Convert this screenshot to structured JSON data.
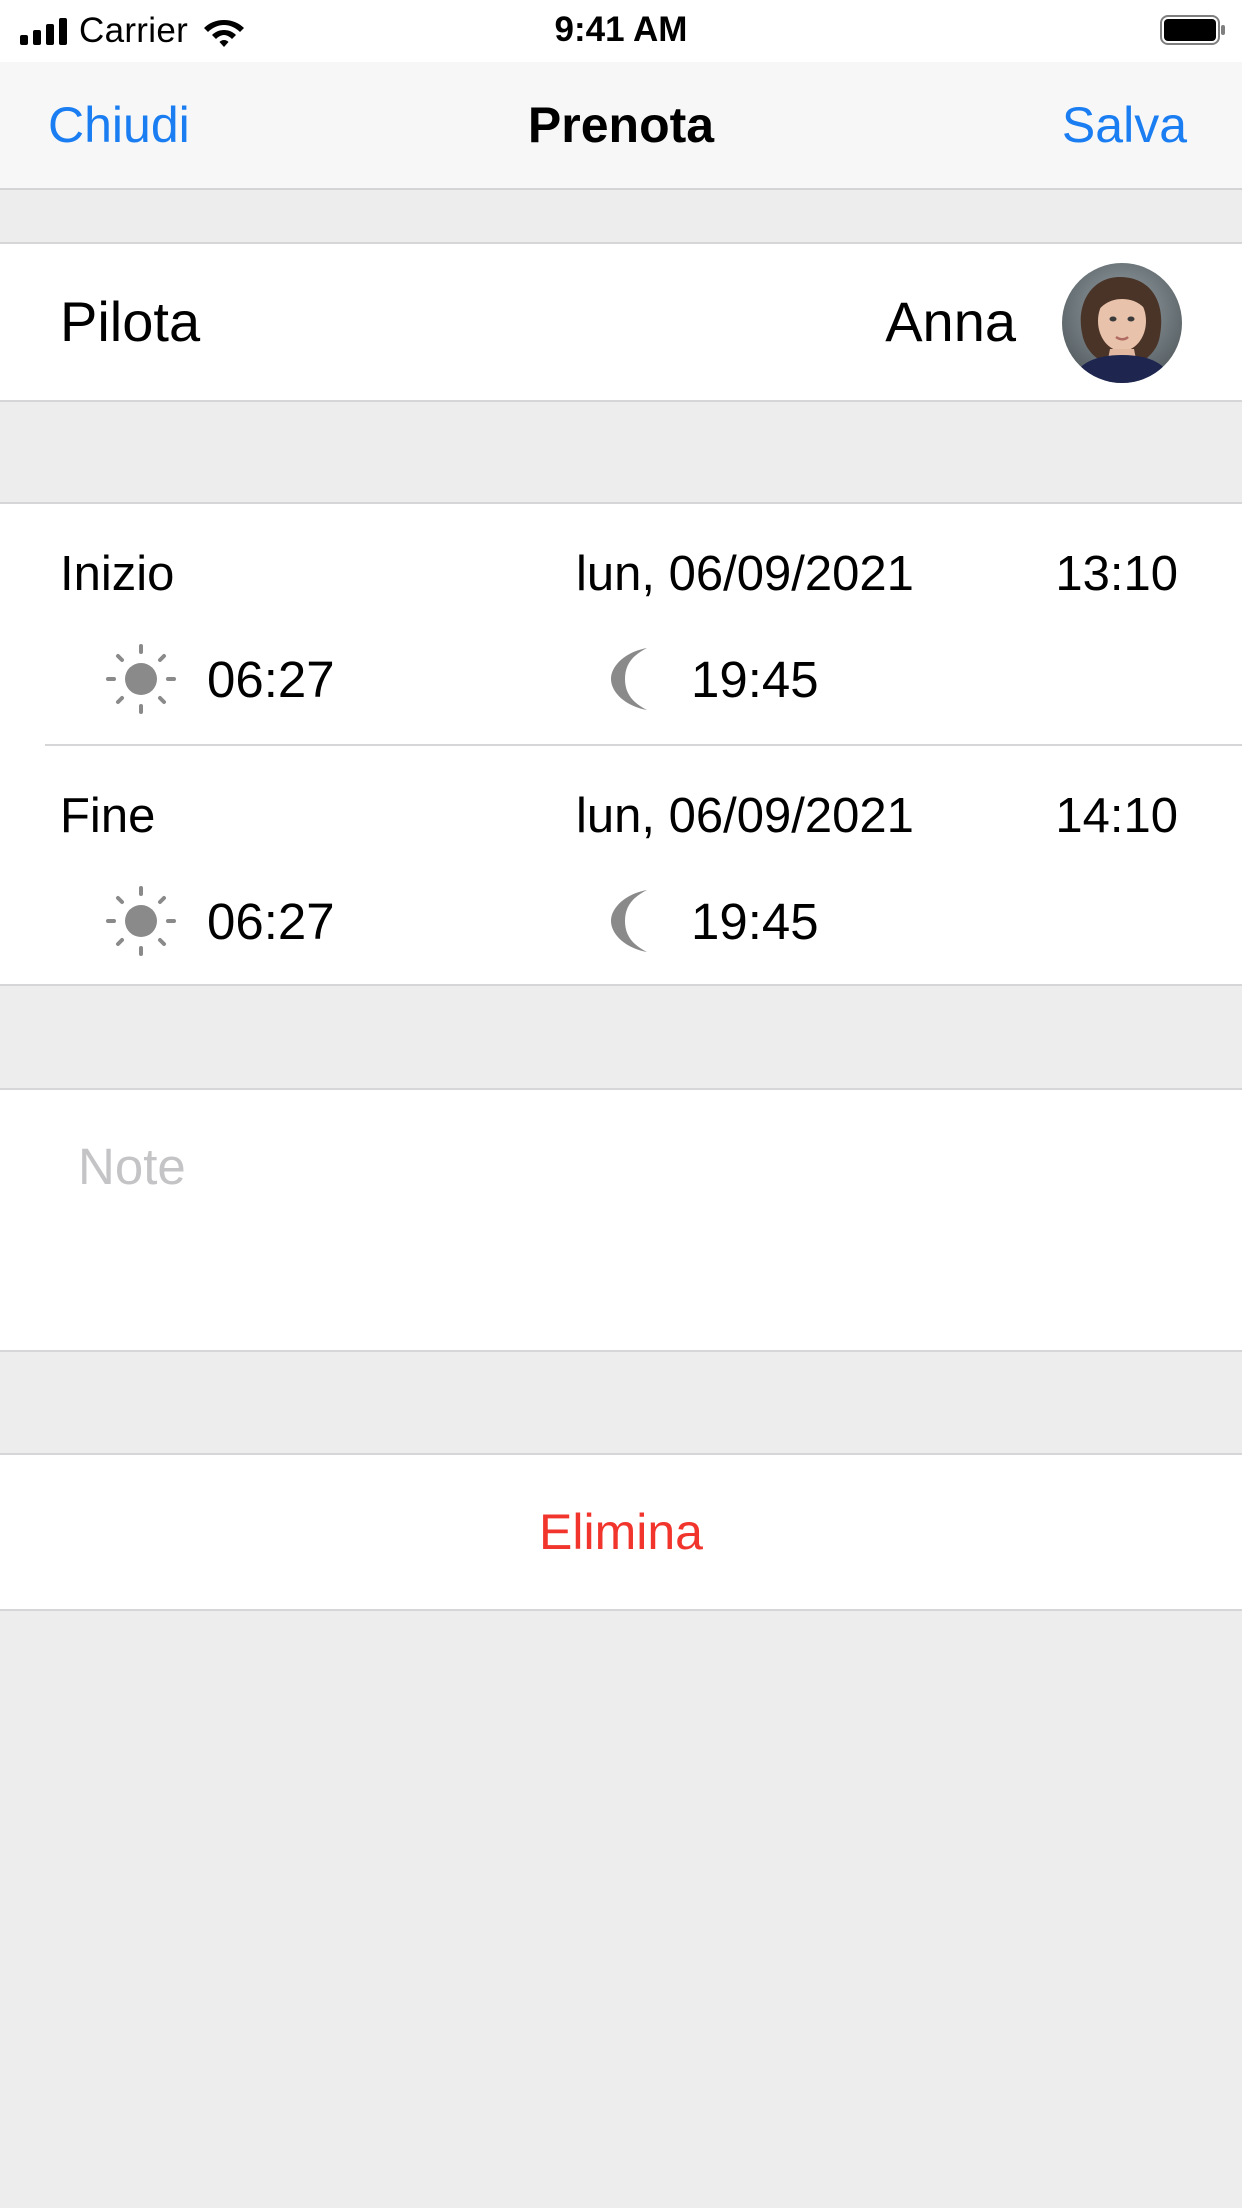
{
  "status_bar": {
    "carrier": "Carrier",
    "time": "9:41 AM",
    "signal_icon": "cellular-signal-icon",
    "wifi_icon": "wifi-icon",
    "battery_icon": "battery-icon"
  },
  "nav": {
    "close_label": "Chiudi",
    "title": "Prenota",
    "save_label": "Salva",
    "accent_color": "#1a7ef2"
  },
  "pilot": {
    "label": "Pilota",
    "name": "Anna",
    "avatar_icon": "avatar-photo"
  },
  "schedule": {
    "start": {
      "label": "Inizio",
      "date": "lun, 06/09/2021",
      "time": "13:10",
      "sunrise": "06:27",
      "sunset": "19:45"
    },
    "end": {
      "label": "Fine",
      "date": "lun, 06/09/2021",
      "time": "14:10",
      "sunrise": "06:27",
      "sunset": "19:45"
    },
    "sunrise_icon": "sun-icon",
    "sunset_icon": "moon-icon"
  },
  "notes": {
    "value": "",
    "placeholder": "Note"
  },
  "actions": {
    "delete_label": "Elimina",
    "delete_color": "#f1352c"
  }
}
